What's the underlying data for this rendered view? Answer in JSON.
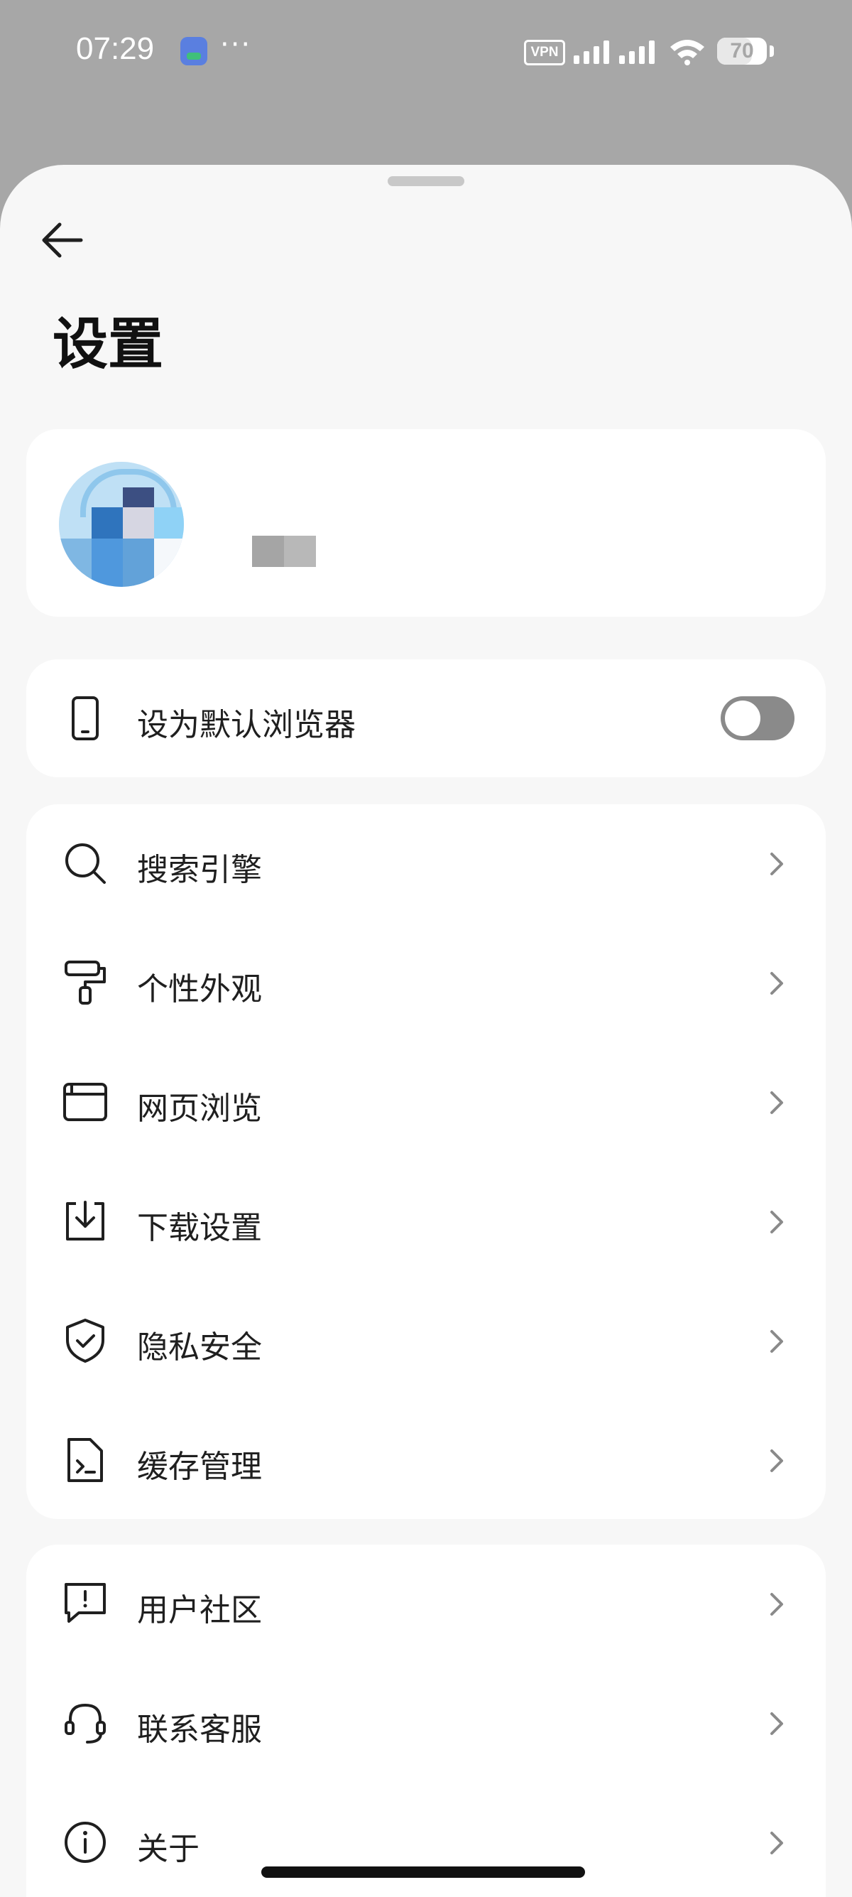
{
  "status_bar": {
    "time": "07:29",
    "notification_more": "···",
    "vpn_label": "VPN",
    "battery_percent": "70",
    "battery_level": 0.7,
    "icons": [
      "app-notification-icon",
      "vpn-icon",
      "signal-icon",
      "wifi-icon",
      "battery-icon"
    ]
  },
  "page": {
    "title": "设置",
    "back_icon": "arrow-left-icon"
  },
  "profile": {
    "avatar_icon": "avatar-icon",
    "username_redacted": true
  },
  "default_browser": {
    "icon": "phone-icon",
    "label": "设为默认浏览器",
    "toggle_on": false
  },
  "settings_group": {
    "items": [
      {
        "icon": "search-icon",
        "label": "搜索引擎"
      },
      {
        "icon": "paint-roller-icon",
        "label": "个性外观"
      },
      {
        "icon": "browser-window-icon",
        "label": "网页浏览"
      },
      {
        "icon": "download-icon",
        "label": "下载设置"
      },
      {
        "icon": "shield-check-icon",
        "label": "隐私安全"
      },
      {
        "icon": "file-terminal-icon",
        "label": "缓存管理"
      }
    ]
  },
  "support_group": {
    "items": [
      {
        "icon": "message-alert-icon",
        "label": "用户社区"
      },
      {
        "icon": "headset-icon",
        "label": "联系客服"
      },
      {
        "icon": "info-icon",
        "label": "关于"
      }
    ]
  },
  "colors": {
    "overlay": "#a7a7a7",
    "sheet_background": "#f7f7f7",
    "card_background": "#ffffff",
    "text": "#1f1f1f",
    "toggle_off": "#8a8a8a",
    "chevron": "#8a8a8a"
  }
}
